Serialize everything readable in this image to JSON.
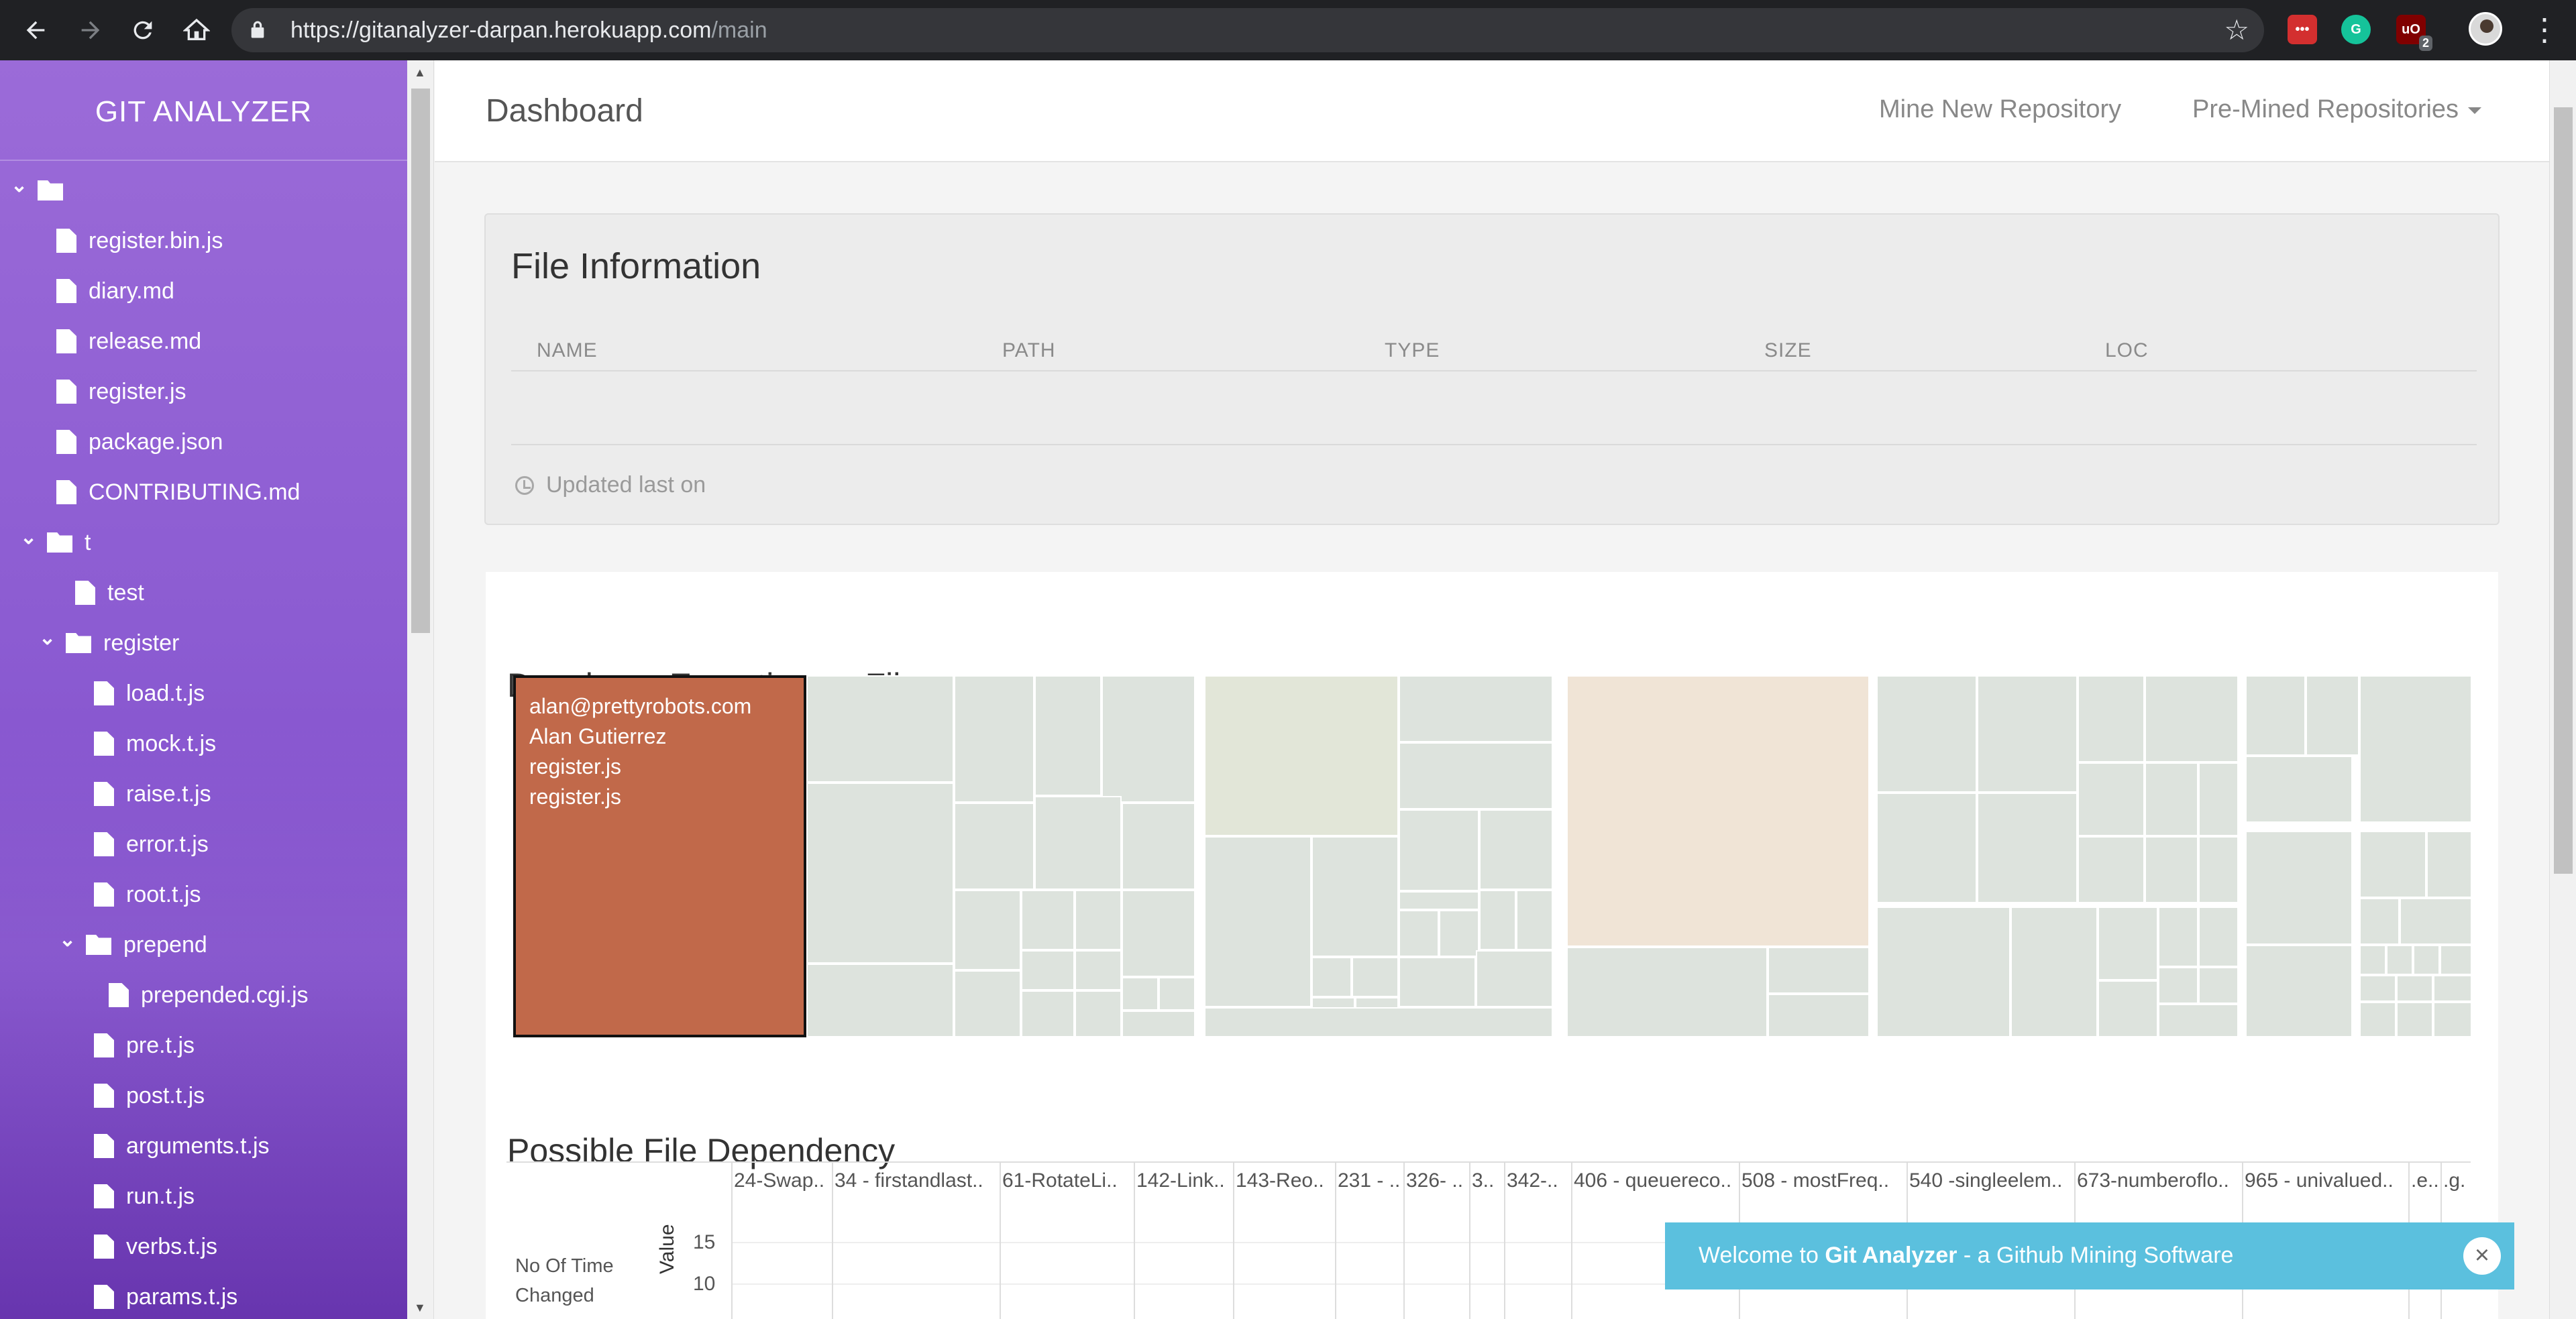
{
  "browser": {
    "url_host": "https://gitanalyzer-darpan.herokuapp.com",
    "url_path": "/main",
    "extensions": [
      "lastpass-icon",
      "grammarly-icon",
      "ublock-icon"
    ],
    "ublock_badge": "2"
  },
  "sidebar": {
    "brand": "GIT ANALYZER",
    "items": [
      {
        "label": "",
        "type": "folder"
      },
      {
        "label": "register.bin.js",
        "type": "file"
      },
      {
        "label": "diary.md",
        "type": "file"
      },
      {
        "label": "release.md",
        "type": "file"
      },
      {
        "label": "register.js",
        "type": "file"
      },
      {
        "label": "package.json",
        "type": "file"
      },
      {
        "label": "CONTRIBUTING.md",
        "type": "file"
      },
      {
        "label": "t",
        "type": "folder"
      },
      {
        "label": "test",
        "type": "file"
      },
      {
        "label": "register",
        "type": "folder"
      },
      {
        "label": "load.t.js",
        "type": "file"
      },
      {
        "label": "mock.t.js",
        "type": "file"
      },
      {
        "label": "raise.t.js",
        "type": "file"
      },
      {
        "label": "error.t.js",
        "type": "file"
      },
      {
        "label": "root.t.js",
        "type": "file"
      },
      {
        "label": "prepend",
        "type": "folder"
      },
      {
        "label": "prepended.cgi.js",
        "type": "file"
      },
      {
        "label": "pre.t.js",
        "type": "file"
      },
      {
        "label": "post.t.js",
        "type": "file"
      },
      {
        "label": "arguments.t.js",
        "type": "file"
      },
      {
        "label": "run.t.js",
        "type": "file"
      },
      {
        "label": "verbs.t.js",
        "type": "file"
      },
      {
        "label": "params.t.js",
        "type": "file"
      }
    ]
  },
  "header": {
    "title": "Dashboard",
    "mine_link": "Mine New Repository",
    "premined_link": "Pre-Mined Repositories"
  },
  "file_info": {
    "title": "File Information",
    "columns": [
      "NAME",
      "PATH",
      "TYPE",
      "SIZE",
      "LOC"
    ],
    "updated_label": "Updated last on"
  },
  "expertise": {
    "title": "Developer Expertise on File",
    "highlight_lines": [
      "alan@prettyrobots.com",
      "Alan Gutierrez",
      "register.js",
      "register.js"
    ],
    "colors": {
      "highlight": "#c1694a",
      "cell": "#dde3dd",
      "olive": "#e2e6d8",
      "peach": "#f0e4d6"
    }
  },
  "dependency": {
    "title": "Possible File Dependency",
    "columns": [
      "24-Swap..",
      "34 - firstandlast..",
      "61-RotateLi..",
      "142-Link..",
      "143-Reo..",
      "231 - ..",
      "326- ..",
      "3..",
      "342-..",
      "406 - queuereco..",
      "508 - mostFreq..",
      "540 -singleelem..",
      "673-numberoflo..",
      "965 - univalued..",
      ".e..",
      ".g."
    ],
    "row_label_line1": "No Of Time",
    "row_label_line2": "Changed",
    "axis_label": "Value",
    "ticks": [
      "15",
      "10"
    ]
  },
  "toast": {
    "prefix": "Welcome to ",
    "strong": "Git Analyzer",
    "suffix": " - a Github Mining Software",
    "close": "×"
  }
}
